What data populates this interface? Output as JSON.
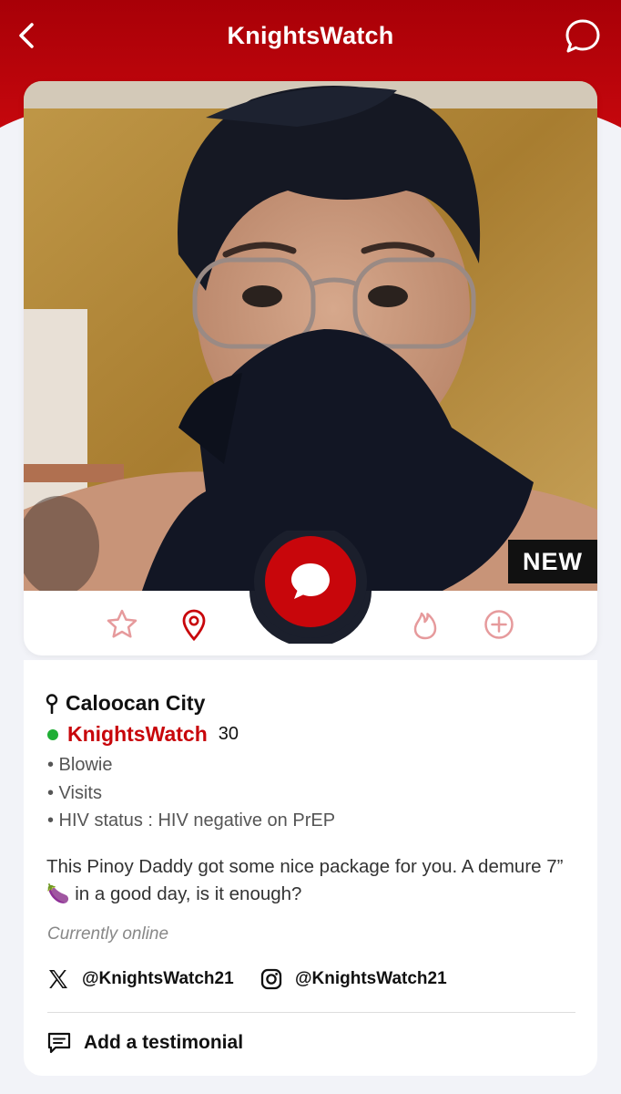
{
  "header": {
    "title": "KnightsWatch",
    "back_icon": "chevron-left-icon",
    "chat_icon": "chat-bubble-icon",
    "bg_color": "#b40008"
  },
  "photo": {
    "badge": "NEW"
  },
  "actions": [
    {
      "icon": "star-icon"
    },
    {
      "icon": "map-pin-icon"
    },
    {
      "icon": "chat-bubble-icon"
    },
    {
      "icon": "flame-icon"
    },
    {
      "icon": "plus-circle-icon"
    }
  ],
  "profile": {
    "location": "Caloocan City",
    "name": "KnightsWatch",
    "age": "30",
    "online_color": "#1fae35",
    "tags": [
      "• Blowie",
      "• Visits",
      "• HIV status : HIV negative on PrEP"
    ],
    "bio": "This Pinoy Daddy got some nice package for you. A demure 7” 🍆 in a good day, is it enough?",
    "status": "Currently online"
  },
  "socials": {
    "x_handle": "@KnightsWatch21",
    "instagram_handle": "@KnightsWatch21"
  },
  "testimonial": {
    "label": "Add a testimonial"
  },
  "accent_color": "#c8060b"
}
